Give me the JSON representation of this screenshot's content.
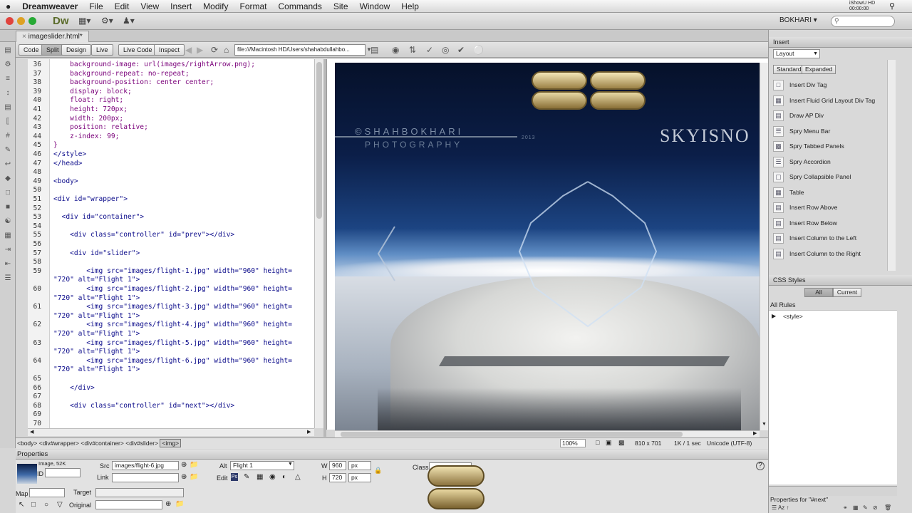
{
  "menubar": {
    "apple": "",
    "app": "Dreamweaver",
    "items": [
      "File",
      "Edit",
      "View",
      "Insert",
      "Modify",
      "Format",
      "Commands",
      "Site",
      "Window",
      "Help"
    ],
    "rec_title": "iShowU HD",
    "rec_time": "00:00:00"
  },
  "appbar": {
    "logo": "Dw",
    "workspace": "BOKHARI"
  },
  "tab": {
    "name": "imageslider.html*"
  },
  "toolbar": {
    "code": "Code",
    "split": "Split",
    "design": "Design",
    "live": "Live",
    "live_code": "Live Code",
    "inspect": "Inspect",
    "url": "file:///Macintosh HD/Users/shahabdullahbo..."
  },
  "code_lines": [
    {
      "n": "36",
      "t": "    background-image: url(images/rightArrow.png);"
    },
    {
      "n": "37",
      "t": "    background-repeat: no-repeat;"
    },
    {
      "n": "38",
      "t": "    background-position: center center;"
    },
    {
      "n": "39",
      "t": "    display: block;"
    },
    {
      "n": "40",
      "t": "    float: right;"
    },
    {
      "n": "41",
      "t": "    height: 720px;"
    },
    {
      "n": "42",
      "t": "    width: 200px;"
    },
    {
      "n": "43",
      "t": "    position: relative;"
    },
    {
      "n": "44",
      "t": "    z-index: 99;"
    },
    {
      "n": "45",
      "t": "}"
    },
    {
      "n": "46",
      "t": "</style>"
    },
    {
      "n": "47",
      "t": "</head>"
    },
    {
      "n": "48",
      "t": ""
    },
    {
      "n": "49",
      "t": "<body>"
    },
    {
      "n": "50",
      "t": ""
    },
    {
      "n": "51",
      "t": "<div id=\"wrapper\">"
    },
    {
      "n": "52",
      "t": ""
    },
    {
      "n": "53",
      "t": "  <div id=\"container\">"
    },
    {
      "n": "54",
      "t": ""
    },
    {
      "n": "55",
      "t": "    <div class=\"controller\" id=\"prev\"></div>"
    },
    {
      "n": "56",
      "t": ""
    },
    {
      "n": "57",
      "t": "    <div id=\"slider\">"
    },
    {
      "n": "58",
      "t": ""
    },
    {
      "n": "59",
      "t": "        <img src=\"images/flight-1.jpg\" width=\"960\" height="
    },
    {
      "n": "",
      "t": "\"720\" alt=\"Flight 1\">"
    },
    {
      "n": "60",
      "t": "        <img src=\"images/flight-2.jpg\" width=\"960\" height="
    },
    {
      "n": "",
      "t": "\"720\" alt=\"Flight 1\">"
    },
    {
      "n": "61",
      "t": "        <img src=\"images/flight-3.jpg\" width=\"960\" height="
    },
    {
      "n": "",
      "t": "\"720\" alt=\"Flight 1\">"
    },
    {
      "n": "62",
      "t": "        <img src=\"images/flight-4.jpg\" width=\"960\" height="
    },
    {
      "n": "",
      "t": "\"720\" alt=\"Flight 1\">"
    },
    {
      "n": "63",
      "t": "        <img src=\"images/flight-5.jpg\" width=\"960\" height="
    },
    {
      "n": "",
      "t": "\"720\" alt=\"Flight 1\">"
    },
    {
      "n": "64",
      "t": "        <img src=\"images/flight-6.jpg\" width=\"960\" height="
    },
    {
      "n": "",
      "t": "\"720\" alt=\"Flight 1\">"
    },
    {
      "n": "65",
      "t": ""
    },
    {
      "n": "66",
      "t": "    </div>"
    },
    {
      "n": "67",
      "t": ""
    },
    {
      "n": "68",
      "t": "    <div class=\"controller\" id=\"next\"></div>"
    },
    {
      "n": "69",
      "t": ""
    },
    {
      "n": "70",
      "t": ""
    }
  ],
  "photo": {
    "watermark1": "©SHAHBOKHARI",
    "watermark2": "PHOTOGRAPHY",
    "year": "2013",
    "sky": "SKYISNO"
  },
  "tagpath": [
    "<body>",
    "<div#wrapper>",
    "<div#container>",
    "<div#slider>",
    "<img>"
  ],
  "status": {
    "zoom": "100%",
    "size": "810 x 701",
    "load": "1K / 1 sec",
    "encoding": "Unicode (UTF-8)"
  },
  "properties": {
    "title": "Properties",
    "type": "Image, 52K",
    "id_label": "ID",
    "src_label": "Src",
    "src": "images/flight-6.jpg",
    "link_label": "Link",
    "alt_label": "Alt",
    "alt": "Flight 1",
    "w_label": "W",
    "w": "960",
    "h_label": "H",
    "h": "720",
    "unit": "px",
    "edit_label": "Edit",
    "class_label": "Class",
    "map_label": "Map",
    "target_label": "Target",
    "original_label": "Original"
  },
  "insert_panel": {
    "title": "Insert",
    "category": "Layout",
    "standard": "Standard",
    "expanded": "Expanded",
    "items": [
      "Insert Div Tag",
      "Insert Fluid Grid Layout Div Tag",
      "Draw AP Div",
      "Spry Menu Bar",
      "Spry Tabbed Panels",
      "Spry Accordion",
      "Spry Collapsible Panel",
      "Table",
      "Insert Row Above",
      "Insert Row Below",
      "Insert Column to the Left",
      "Insert Column to the Right"
    ]
  },
  "css_panel": {
    "title": "CSS Styles",
    "all": "All",
    "current": "Current",
    "all_rules": "All Rules",
    "rule": "<style>",
    "props_for": "Properties for \"#next\""
  },
  "colors": {
    "accent": "#5a6b2a",
    "selection": "#a9a9a9"
  }
}
